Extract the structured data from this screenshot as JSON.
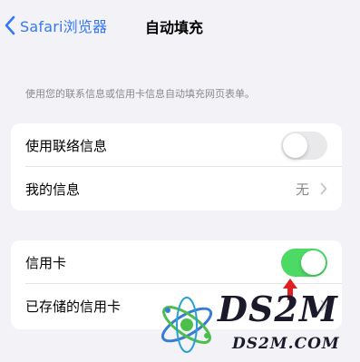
{
  "nav": {
    "back_label": "Safari浏览器",
    "title": "自动填充"
  },
  "description": "使用您的联系信息或信用卡信息自动填充网页表单。",
  "group1": {
    "contact_label": "使用联络信息",
    "contact_toggle_on": false,
    "my_info_label": "我的信息",
    "my_info_value": "无"
  },
  "group2": {
    "credit_card_label": "信用卡",
    "credit_card_toggle_on": true,
    "saved_cards_label": "已存储的信用卡"
  },
  "colors": {
    "accent": "#3478f6",
    "toggle_on": "#4cd964",
    "toggle_off": "#e9e9eb",
    "arrow": "#e02020"
  },
  "watermark": {
    "big": "DS2M",
    "small": "DS2M.COM"
  }
}
